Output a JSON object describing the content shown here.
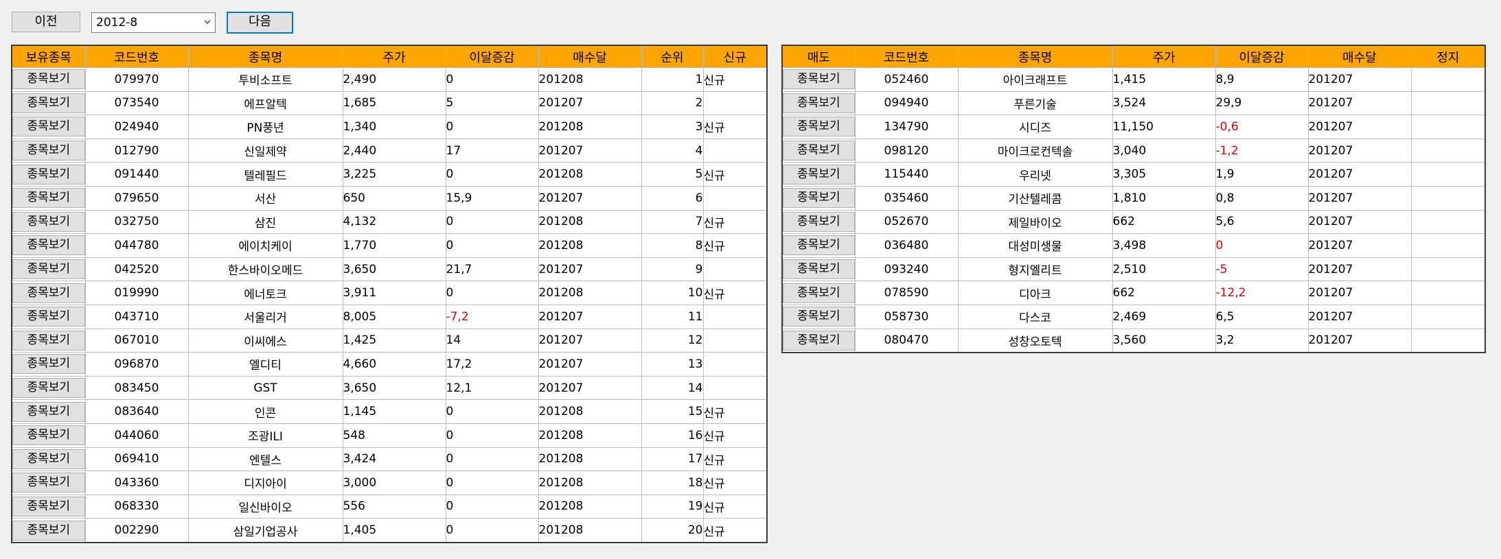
{
  "toolbar": {
    "prev_label": "이전",
    "next_label": "다음",
    "month_value": "2012-8"
  },
  "left_table": {
    "headers": [
      "보유종목",
      "코드번호",
      "종목명",
      "주가",
      "이달증감",
      "매수달",
      "순위",
      "신규"
    ],
    "button_label": "종목보기",
    "rows": [
      {
        "code": "079970",
        "name": "투비소프트",
        "price": "2,490",
        "change": "0",
        "month": "201208",
        "rank": "1",
        "new": "신규"
      },
      {
        "code": "073540",
        "name": "에프알텍",
        "price": "1,685",
        "change": "5",
        "month": "201207",
        "rank": "2",
        "new": ""
      },
      {
        "code": "024940",
        "name": "PN풍년",
        "price": "1,340",
        "change": "0",
        "month": "201208",
        "rank": "3",
        "new": "신규"
      },
      {
        "code": "012790",
        "name": "신일제약",
        "price": "2,440",
        "change": "17",
        "month": "201207",
        "rank": "4",
        "new": ""
      },
      {
        "code": "091440",
        "name": "텔레필드",
        "price": "3,225",
        "change": "0",
        "month": "201208",
        "rank": "5",
        "new": "신규"
      },
      {
        "code": "079650",
        "name": "서산",
        "price": "650",
        "change": "15,9",
        "month": "201207",
        "rank": "6",
        "new": ""
      },
      {
        "code": "032750",
        "name": "삼진",
        "price": "4,132",
        "change": "0",
        "month": "201208",
        "rank": "7",
        "new": "신규"
      },
      {
        "code": "044780",
        "name": "에이치케이",
        "price": "1,770",
        "change": "0",
        "month": "201208",
        "rank": "8",
        "new": "신규"
      },
      {
        "code": "042520",
        "name": "한스바이오메드",
        "price": "3,650",
        "change": "21,7",
        "month": "201207",
        "rank": "9",
        "new": ""
      },
      {
        "code": "019990",
        "name": "에너토크",
        "price": "3,911",
        "change": "0",
        "month": "201208",
        "rank": "10",
        "new": "신규"
      },
      {
        "code": "043710",
        "name": "서울리거",
        "price": "8,005",
        "change": "-7,2",
        "month": "201207",
        "rank": "11",
        "new": ""
      },
      {
        "code": "067010",
        "name": "이씨에스",
        "price": "1,425",
        "change": "14",
        "month": "201207",
        "rank": "12",
        "new": ""
      },
      {
        "code": "096870",
        "name": "엘디티",
        "price": "4,660",
        "change": "17,2",
        "month": "201207",
        "rank": "13",
        "new": ""
      },
      {
        "code": "083450",
        "name": "GST",
        "price": "3,650",
        "change": "12,1",
        "month": "201207",
        "rank": "14",
        "new": ""
      },
      {
        "code": "083640",
        "name": "인콘",
        "price": "1,145",
        "change": "0",
        "month": "201208",
        "rank": "15",
        "new": "신규"
      },
      {
        "code": "044060",
        "name": "조광ILI",
        "price": "548",
        "change": "0",
        "month": "201208",
        "rank": "16",
        "new": "신규"
      },
      {
        "code": "069410",
        "name": "엔텔스",
        "price": "3,424",
        "change": "0",
        "month": "201208",
        "rank": "17",
        "new": "신규"
      },
      {
        "code": "043360",
        "name": "디지아이",
        "price": "3,000",
        "change": "0",
        "month": "201208",
        "rank": "18",
        "new": "신규"
      },
      {
        "code": "068330",
        "name": "일신바이오",
        "price": "556",
        "change": "0",
        "month": "201208",
        "rank": "19",
        "new": "신규"
      },
      {
        "code": "002290",
        "name": "삼일기업공사",
        "price": "1,405",
        "change": "0",
        "month": "201208",
        "rank": "20",
        "new": "신규"
      }
    ]
  },
  "right_table": {
    "headers": [
      "매도",
      "코드번호",
      "종목명",
      "주가",
      "이달증감",
      "매수달",
      "정지"
    ],
    "button_label": "종목보기",
    "rows": [
      {
        "code": "052460",
        "name": "아이크래프트",
        "price": "1,415",
        "change": "8,9",
        "month": "201207",
        "stop": ""
      },
      {
        "code": "094940",
        "name": "푸른기술",
        "price": "3,524",
        "change": "29,9",
        "month": "201207",
        "stop": ""
      },
      {
        "code": "134790",
        "name": "시디즈",
        "price": "11,150",
        "change": "-0,6",
        "month": "201207",
        "stop": ""
      },
      {
        "code": "098120",
        "name": "마이크로컨텍솔",
        "price": "3,040",
        "change": "-1,2",
        "month": "201207",
        "stop": ""
      },
      {
        "code": "115440",
        "name": "우리넷",
        "price": "3,305",
        "change": "1,9",
        "month": "201207",
        "stop": ""
      },
      {
        "code": "035460",
        "name": "기산텔레콤",
        "price": "1,810",
        "change": "0,8",
        "month": "201207",
        "stop": ""
      },
      {
        "code": "052670",
        "name": "제일바이오",
        "price": "662",
        "change": "5,6",
        "month": "201207",
        "stop": ""
      },
      {
        "code": "036480",
        "name": "대성미생물",
        "price": "3,498",
        "change": "0",
        "month": "201207",
        "stop": ""
      },
      {
        "code": "093240",
        "name": "형지엘리트",
        "price": "2,510",
        "change": "-5",
        "month": "201207",
        "stop": ""
      },
      {
        "code": "078590",
        "name": "디아크",
        "price": "662",
        "change": "-12,2",
        "month": "201207",
        "stop": ""
      },
      {
        "code": "058730",
        "name": "다스코",
        "price": "2,469",
        "change": "6,5",
        "month": "201207",
        "stop": ""
      },
      {
        "code": "080470",
        "name": "성창오토텍",
        "price": "3,560",
        "change": "3,2",
        "month": "201207",
        "stop": ""
      }
    ]
  },
  "colors": {
    "header_bg": "#ffa500",
    "negative_text": "#e10000",
    "focus_border": "#0078d7"
  },
  "icons": {
    "dropdown": "chevron-down-icon"
  }
}
